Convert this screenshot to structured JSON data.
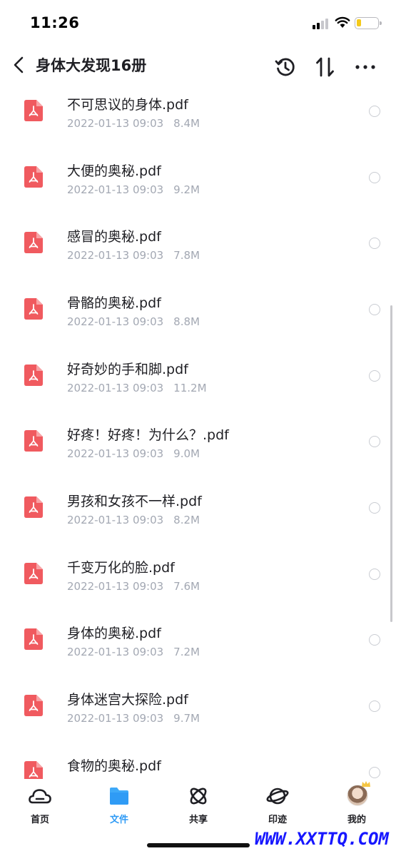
{
  "status_bar": {
    "time": "11:26"
  },
  "nav": {
    "title": "身体大发现16册",
    "back_icon": "chevron-left-icon",
    "history_icon": "history-icon",
    "sort_icon": "sort-icon",
    "more_icon": "more-horizontal-icon"
  },
  "colors": {
    "accent": "#2f9bf5",
    "pdf_red": "#f05a5f",
    "meta_gray": "#a3a8b3"
  },
  "files": [
    {
      "name": "不可思议的身体.pdf",
      "date": "2022-01-13 09:03",
      "size": "8.4M"
    },
    {
      "name": "大便的奥秘.pdf",
      "date": "2022-01-13 09:03",
      "size": "9.2M"
    },
    {
      "name": "感冒的奥秘.pdf",
      "date": "2022-01-13 09:03",
      "size": "7.8M"
    },
    {
      "name": "骨骼的奥秘.pdf",
      "date": "2022-01-13 09:03",
      "size": "8.8M"
    },
    {
      "name": "好奇妙的手和脚.pdf",
      "date": "2022-01-13 09:03",
      "size": "11.2M"
    },
    {
      "name": "好疼！好疼！为什么？.pdf",
      "date": "2022-01-13 09:03",
      "size": "9.0M"
    },
    {
      "name": "男孩和女孩不一样.pdf",
      "date": "2022-01-13 09:03",
      "size": "8.2M"
    },
    {
      "name": "千变万化的脸.pdf",
      "date": "2022-01-13 09:03",
      "size": "7.6M"
    },
    {
      "name": "身体的奥秘.pdf",
      "date": "2022-01-13 09:03",
      "size": "7.2M"
    },
    {
      "name": "身体迷宫大探险.pdf",
      "date": "2022-01-13 09:03",
      "size": "9.7M"
    },
    {
      "name": "食物的奥秘.pdf",
      "date": "",
      "size": ""
    }
  ],
  "tabs": [
    {
      "label": "首页",
      "icon": "home-cloud-icon"
    },
    {
      "label": "文件",
      "icon": "folder-icon",
      "active": true
    },
    {
      "label": "共享",
      "icon": "share-atom-icon"
    },
    {
      "label": "印迹",
      "icon": "planet-icon"
    },
    {
      "label": "我的",
      "icon": "avatar"
    }
  ],
  "watermark": "WWW.XXTTQ.COM"
}
